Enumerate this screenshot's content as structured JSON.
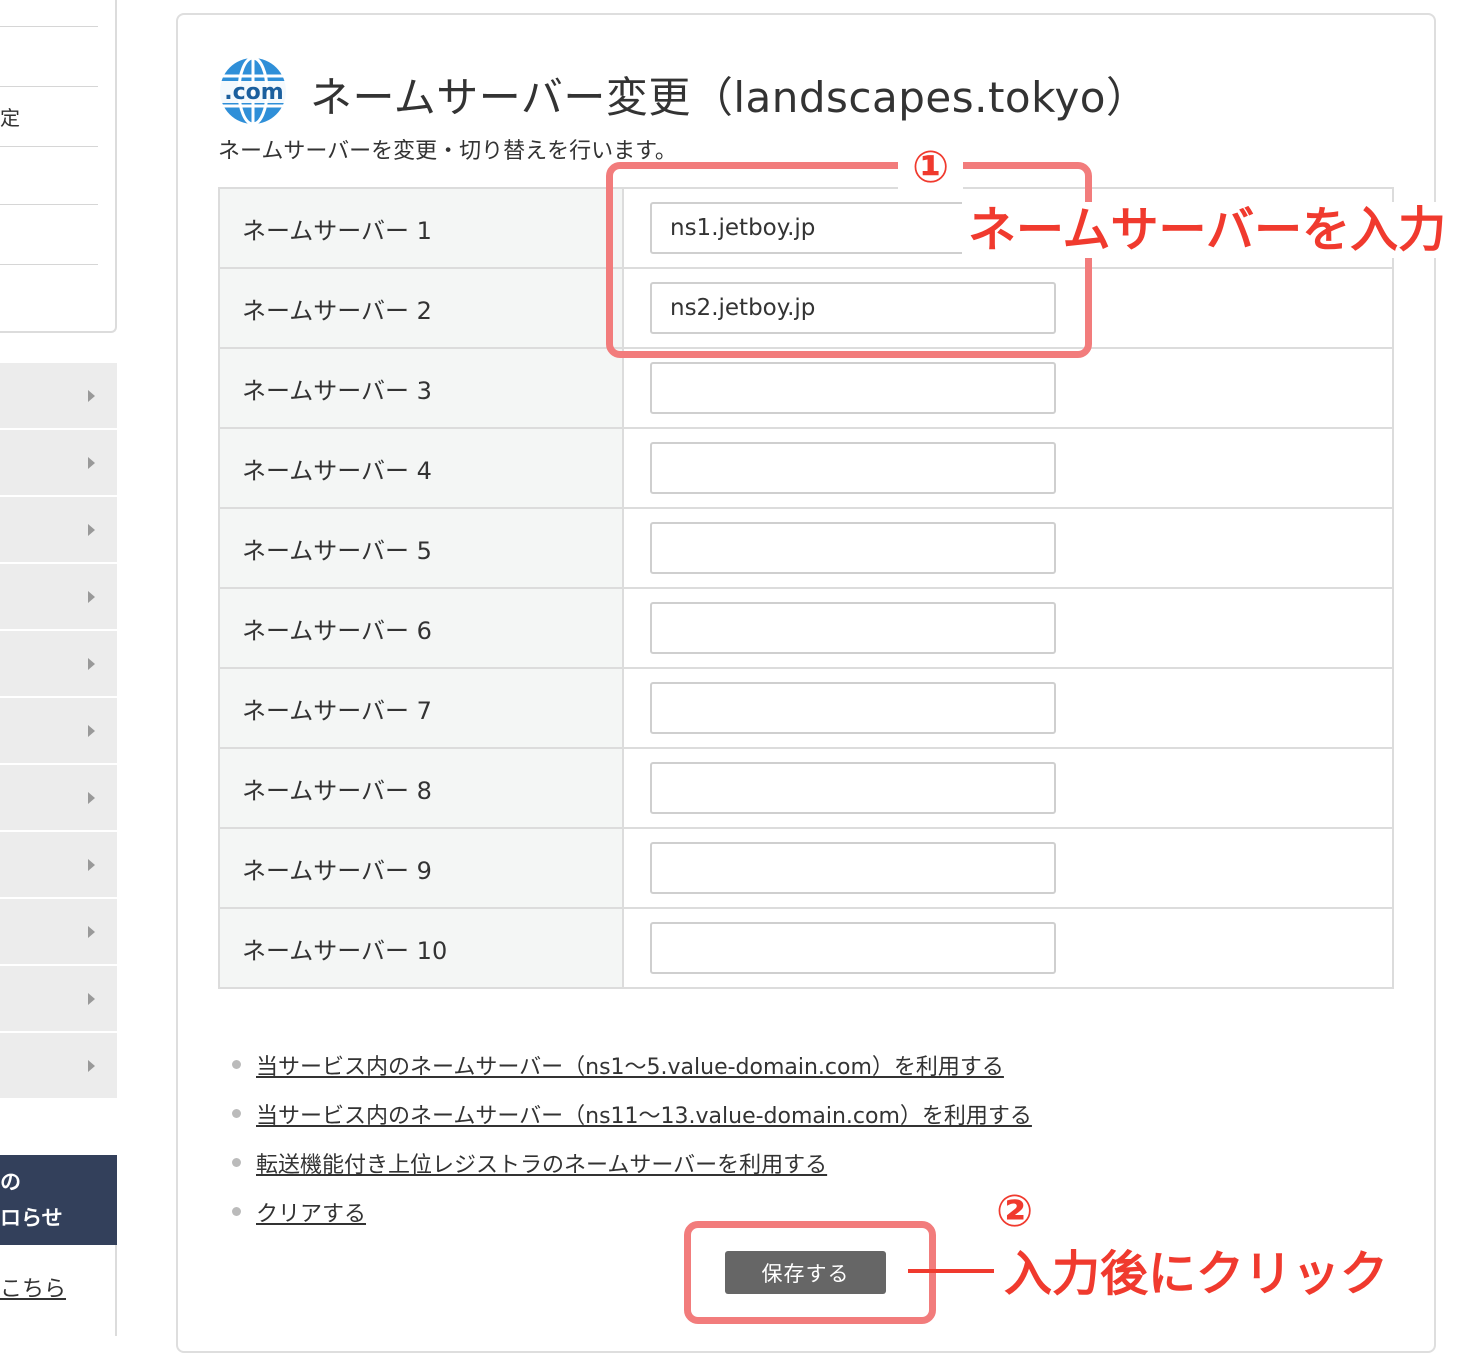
{
  "sidebar": {
    "top_fragment": "定",
    "notice_line1": "の",
    "notice_line2": "ロらせ",
    "bottom_link": "こちら"
  },
  "page": {
    "icon": "dotcom-globe-icon",
    "icon_text": ".com",
    "title": "ネームサーバー変更（landscapes.tokyo）",
    "subtitle": "ネームサーバーを変更・切り替えを行います。"
  },
  "nameservers": [
    {
      "label": "ネームサーバー 1",
      "value": "ns1.jetboy.jp"
    },
    {
      "label": "ネームサーバー 2",
      "value": "ns2.jetboy.jp"
    },
    {
      "label": "ネームサーバー 3",
      "value": ""
    },
    {
      "label": "ネームサーバー 4",
      "value": ""
    },
    {
      "label": "ネームサーバー 5",
      "value": ""
    },
    {
      "label": "ネームサーバー 6",
      "value": ""
    },
    {
      "label": "ネームサーバー 7",
      "value": ""
    },
    {
      "label": "ネームサーバー 8",
      "value": ""
    },
    {
      "label": "ネームサーバー 9",
      "value": ""
    },
    {
      "label": "ネームサーバー 10",
      "value": ""
    }
  ],
  "links": [
    "当サービス内のネームサーバー（ns1〜5.value-domain.com）を利用する",
    "当サービス内のネームサーバー（ns11〜13.value-domain.com）を利用する",
    "転送機能付き上位レジストラのネームサーバーを利用する",
    "クリアする"
  ],
  "save_button": "保存する",
  "annotations": {
    "step1_number": "①",
    "step1_text": "ネームサーバーを入力",
    "step2_number": "②",
    "step2_text": "入力後にクリック",
    "highlight_color": "#f27c7c",
    "text_color": "#f03a2e"
  }
}
